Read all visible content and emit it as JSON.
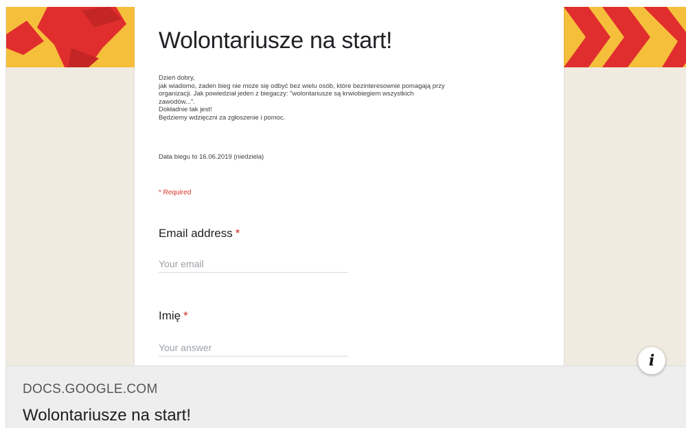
{
  "form": {
    "title": "Wolontariusze na start!",
    "description_lines": [
      "Dzień dobry,",
      "jak wiadomo, żaden bieg nie może się odbyć bez wielu osób, które bezinteresownie pomagają przy",
      "organizacji. Jak powiedział jeden z biegaczy: \"wolontariusze są krwiobiegiem wszystkich",
      "zawodów...\".",
      "Dokładnie tak jest!",
      "Będziemy wdzięczni za zgłoszenie i pomoc."
    ],
    "date_line": "Data biegu to 16.06.2019 (niedziela)",
    "required_note": "* Required",
    "questions": [
      {
        "label": "Email address",
        "required_mark": "*",
        "placeholder": "Your email"
      },
      {
        "label": "Imię",
        "required_mark": "*",
        "placeholder": "Your answer"
      }
    ]
  },
  "link_preview": {
    "domain": "DOCS.GOOGLE.COM",
    "title": "Wolontariusze na start!"
  },
  "info_button": {
    "icon": "info-icon",
    "glyph": "i"
  },
  "colors": {
    "banner_yellow": "#f6bf3b",
    "banner_red": "#e02e2e",
    "page_background": "#f0ebe1",
    "required_red": "#d93025",
    "footer_background": "#eeeeee"
  }
}
